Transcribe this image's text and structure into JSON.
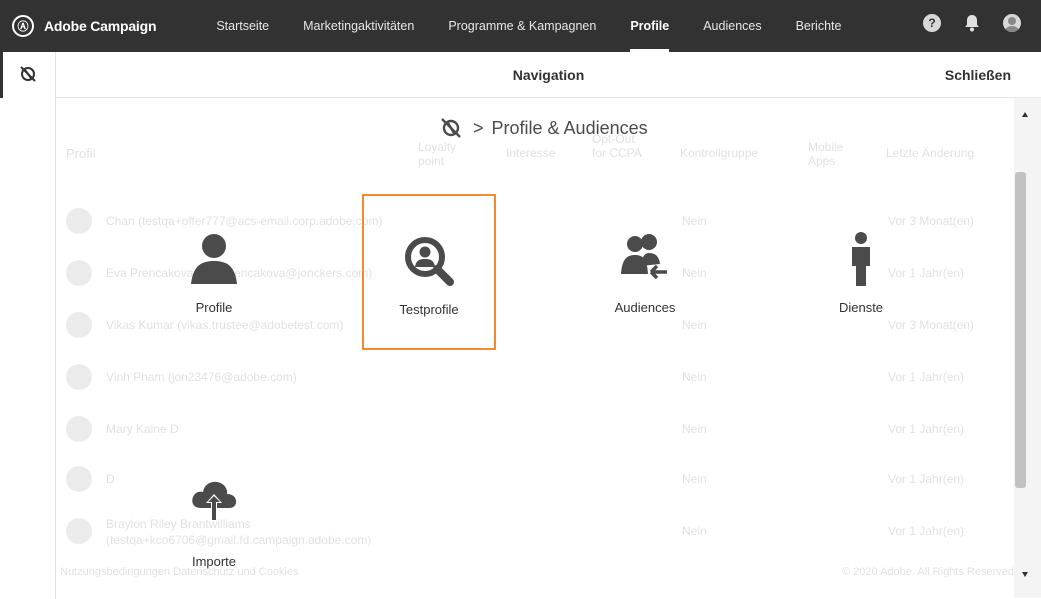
{
  "app": {
    "name": "Adobe Campaign",
    "logo_glyph": "Ⓐ"
  },
  "top_nav": [
    {
      "label": "Startseite",
      "active": false
    },
    {
      "label": "Marketingaktivitäten",
      "active": false
    },
    {
      "label": "Programme & Kampagnen",
      "active": false
    },
    {
      "label": "Profile",
      "active": true
    },
    {
      "label": "Audiences",
      "active": false
    },
    {
      "label": "Berichte",
      "active": false
    }
  ],
  "top_icons": {
    "help_glyph": "?",
    "bell": "bell-icon",
    "user": "user-avatar-icon"
  },
  "navigation": {
    "title": "Navigation",
    "close_label": "Schließen"
  },
  "breadcrumb": {
    "separator": ">",
    "current": "Profile & Audiences"
  },
  "tiles": [
    {
      "label": "Profile",
      "icon": "person-icon",
      "selected": false
    },
    {
      "label": "Testprofile",
      "icon": "search-person-icon",
      "selected": true
    },
    {
      "label": "Audiences",
      "icon": "audiences-icon",
      "selected": false
    },
    {
      "label": "Dienste",
      "icon": "service-person-icon",
      "selected": false
    },
    {
      "label": "Importe",
      "icon": "cloud-upload-icon",
      "selected": false
    }
  ],
  "background_table": {
    "headers": [
      "Profil",
      "Loyalty point",
      "Interesse",
      "Opt-Out for CCPA",
      "Kontrollgruppe",
      "Mobile Apps",
      "Letzte Änderung"
    ],
    "rows": [
      {
        "name": "Chan (testqa+offer777@acs-email.corp.adobe.com)",
        "kontroll": "Nein",
        "when": "Vor 3 Monat(en)"
      },
      {
        "name": "Eva Prencakova (eva.prencakova@jonckers.com)",
        "kontroll": "Nein",
        "when": "Vor 1 Jahr(en)"
      },
      {
        "name": "Vikas Kumar (vikas.trustee@adobetest.com)",
        "kontroll": "Nein",
        "when": "Vor 3 Monat(en)"
      },
      {
        "name": "Vinh Pham (jon23476@adobe.com)",
        "kontroll": "Nein",
        "when": "Vor 1 Jahr(en)"
      },
      {
        "name": "Mary Kalne D",
        "kontroll": "Nein",
        "when": "Vor 1 Jahr(en)"
      },
      {
        "name": "D",
        "kontroll": "Nein",
        "when": "Vor 1 Jahr(en)"
      },
      {
        "name": "Braylon Riley Brantwilliams (testqa+kco6706@gmail.fd.campaign.adobe.com)",
        "kontroll": "Nein",
        "when": "Vor 1 Jahr(en)"
      }
    ],
    "footer_left": "Nutzungsbedingungen    Datenschutz und Cookies",
    "footer_right": "© 2020 Adobe. All Rights Reserved"
  },
  "colors": {
    "topbar": "#323232",
    "accent_selected": "#f4892f",
    "icon": "#4b4b4b"
  }
}
